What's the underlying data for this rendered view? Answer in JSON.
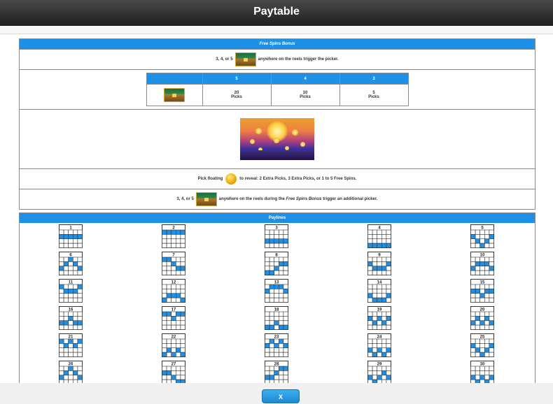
{
  "header": {
    "title": "Paytable"
  },
  "free_spins": {
    "title": "Free Spins Bonus",
    "trigger_prefix": "3, 4, or 5",
    "trigger_suffix": "anywhere on the reels trigger the picker.",
    "table": {
      "headers": [
        "5",
        "4",
        "3"
      ],
      "values": [
        {
          "count": "20",
          "unit": "Picks"
        },
        {
          "count": "10",
          "unit": "Picks"
        },
        {
          "count": "5",
          "unit": "Picks"
        }
      ]
    },
    "pick_prefix": "Pick floating",
    "pick_suffix": "to reveal: 2 Extra Picks, 3 Extra Picks, or 1 to 5 Free Spins.",
    "retrigger_prefix": "3, 4, or 5",
    "retrigger_mid": "anywhere on the reels during the",
    "retrigger_bonus": "Free Spins Bonus",
    "retrigger_suffix": "trigger an additional picker."
  },
  "paylines_section": {
    "title": "Paylines",
    "lines": [
      {
        "label": "1",
        "rows": [
          1,
          1,
          1,
          1,
          1
        ]
      },
      {
        "label": "2",
        "rows": [
          0,
          0,
          0,
          0,
          0
        ]
      },
      {
        "label": "3",
        "rows": [
          2,
          2,
          2,
          2,
          2
        ]
      },
      {
        "label": "4",
        "rows": [
          3,
          3,
          3,
          3,
          3
        ]
      },
      {
        "label": "5",
        "rows": [
          1,
          2,
          3,
          2,
          1
        ]
      },
      {
        "label": "6",
        "rows": [
          2,
          1,
          0,
          1,
          2
        ]
      },
      {
        "label": "7",
        "rows": [
          0,
          0,
          1,
          2,
          2
        ]
      },
      {
        "label": "8",
        "rows": [
          3,
          3,
          2,
          1,
          1
        ]
      },
      {
        "label": "9",
        "rows": [
          1,
          2,
          2,
          2,
          1
        ]
      },
      {
        "label": "10",
        "rows": [
          2,
          1,
          1,
          1,
          2
        ]
      },
      {
        "label": "11",
        "rows": [
          0,
          1,
          1,
          1,
          0
        ]
      },
      {
        "label": "12",
        "rows": [
          3,
          2,
          2,
          2,
          3
        ]
      },
      {
        "label": "13",
        "rows": [
          1,
          0,
          0,
          0,
          1
        ]
      },
      {
        "label": "14",
        "rows": [
          2,
          3,
          3,
          3,
          2
        ]
      },
      {
        "label": "15",
        "rows": [
          1,
          1,
          2,
          1,
          1
        ]
      },
      {
        "label": "16",
        "rows": [
          2,
          2,
          1,
          2,
          2
        ]
      },
      {
        "label": "17",
        "rows": [
          0,
          0,
          1,
          0,
          0
        ]
      },
      {
        "label": "18",
        "rows": [
          3,
          3,
          2,
          3,
          3
        ]
      },
      {
        "label": "19",
        "rows": [
          1,
          2,
          1,
          2,
          1
        ]
      },
      {
        "label": "20",
        "rows": [
          2,
          1,
          2,
          1,
          2
        ]
      },
      {
        "label": "21",
        "rows": [
          0,
          1,
          0,
          1,
          0
        ]
      },
      {
        "label": "22",
        "rows": [
          3,
          2,
          3,
          2,
          3
        ]
      },
      {
        "label": "23",
        "rows": [
          1,
          0,
          1,
          0,
          1
        ]
      },
      {
        "label": "24",
        "rows": [
          2,
          3,
          2,
          3,
          2
        ]
      },
      {
        "label": "25",
        "rows": [
          1,
          2,
          3,
          2,
          1
        ]
      },
      {
        "label": "26",
        "rows": [
          2,
          1,
          0,
          1,
          2
        ]
      },
      {
        "label": "27",
        "rows": [
          1,
          1,
          2,
          3,
          3
        ]
      },
      {
        "label": "28",
        "rows": [
          2,
          2,
          1,
          0,
          0
        ]
      },
      {
        "label": "29",
        "rows": [
          2,
          3,
          2,
          1,
          2
        ]
      },
      {
        "label": "30",
        "rows": [
          2,
          3,
          2,
          3,
          2
        ]
      }
    ]
  },
  "close_button": {
    "label": "X"
  },
  "colors": {
    "accent": "#1e90e8",
    "border": "#8a8a8a"
  }
}
